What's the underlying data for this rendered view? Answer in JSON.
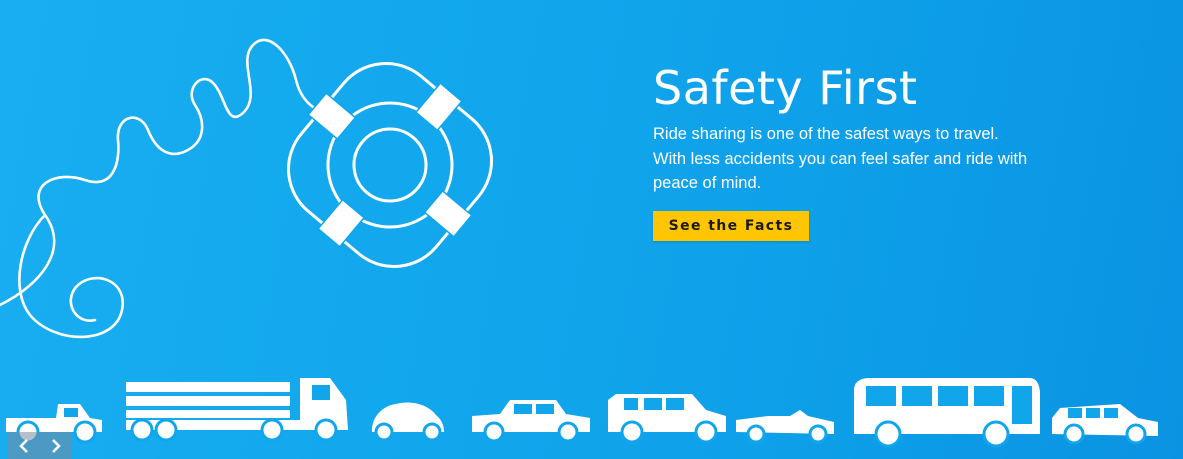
{
  "hero": {
    "title": "Safety First",
    "body": "Ride sharing is one of the safest ways to travel. With less accidents you can feel safer and ride with peace of mind.",
    "cta_label": "See the Facts"
  },
  "illustration": {
    "icon": "life-ring-icon"
  },
  "vehicles": [
    "pickup-truck-icon",
    "flatbed-truck-icon",
    "beetle-car-icon",
    "sedan-icon",
    "suv-icon",
    "convertible-icon",
    "bus-icon",
    "station-wagon-icon"
  ],
  "slider_nav": {
    "prev_icon": "chevron-left-icon",
    "next_icon": "chevron-right-icon"
  },
  "colors": {
    "background": "#11a6ec",
    "cta": "#ffc600",
    "text": "#ffffff"
  }
}
